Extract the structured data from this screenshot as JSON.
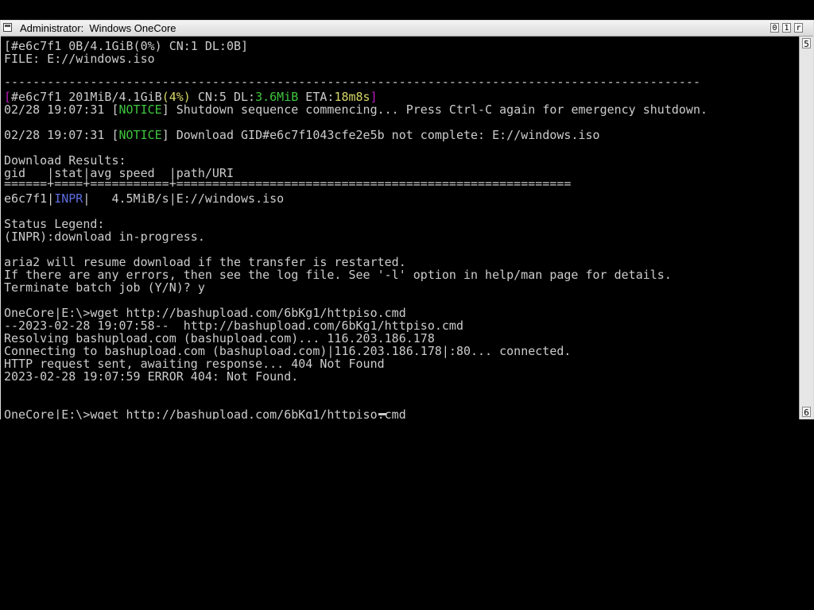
{
  "window": {
    "title": "Administrator:  Windows OneCore",
    "buttons": [
      "0",
      "1",
      "r"
    ],
    "scroll_top_label": "5",
    "scroll_bottom_label": "6"
  },
  "console": {
    "line1": "[#e6c7f1 0B/4.1GiB(0%) CN:1 DL:0B]",
    "line2": "FILE: E://windows.iso",
    "dash_line": "-------------------------------------------------------------------------------------------------",
    "progress": {
      "open": "[",
      "id": "#e6c7f1 201MiB/4.1GiB",
      "pct": "(4%)",
      "cn": " CN:5 DL:",
      "dl": "3.6MiB",
      "eta_label": " ETA:",
      "eta": "18m8s",
      "close": "]"
    },
    "notice1": {
      "time": "02/28 19:07:31 [",
      "tag": "NOTICE",
      "msg": "] Shutdown sequence commencing... Press Ctrl-C again for emergency shutdown."
    },
    "notice2": {
      "time": "02/28 19:07:31 [",
      "tag": "NOTICE",
      "msg": "] Download GID#e6c7f1043cfe2e5b not complete: E://windows.iso"
    },
    "results_title": "Download Results:",
    "results_header": "gid   |stat|avg speed  |path/URI",
    "results_sep": "======+====+===========+=======================================================",
    "result_row": {
      "gid": "e6c7f1|",
      "stat": "INPR",
      "rest": "|   4.5MiB/s|E://windows.iso"
    },
    "legend_title": "Status Legend:",
    "legend_inpr": "(INPR):download in-progress.",
    "resume": "aria2 will resume download if the transfer is restarted.",
    "errors": "If there are any errors, then see the log file. See '-l' option in help/man page for details.",
    "terminate": "Terminate batch job (Y/N)? y",
    "cmd1": "OneCore|E:\\>wget http://bashupload.com/6bKg1/httpiso.cmd",
    "wget1": "--2023-02-28 19:07:58--  http://bashupload.com/6bKg1/httpiso.cmd",
    "wget2": "Resolving bashupload.com (bashupload.com)... 116.203.186.178",
    "wget3": "Connecting to bashupload.com (bashupload.com)|116.203.186.178|:80... connected.",
    "wget4": "HTTP request sent, awaiting response... 404 Not Found",
    "wget5": "2023-02-28 19:07:59 ERROR 404: Not Found.",
    "cmd2": "OneCore|E:\\>wget http://bashupload.com/6bKg1/httpiso.cmd"
  }
}
